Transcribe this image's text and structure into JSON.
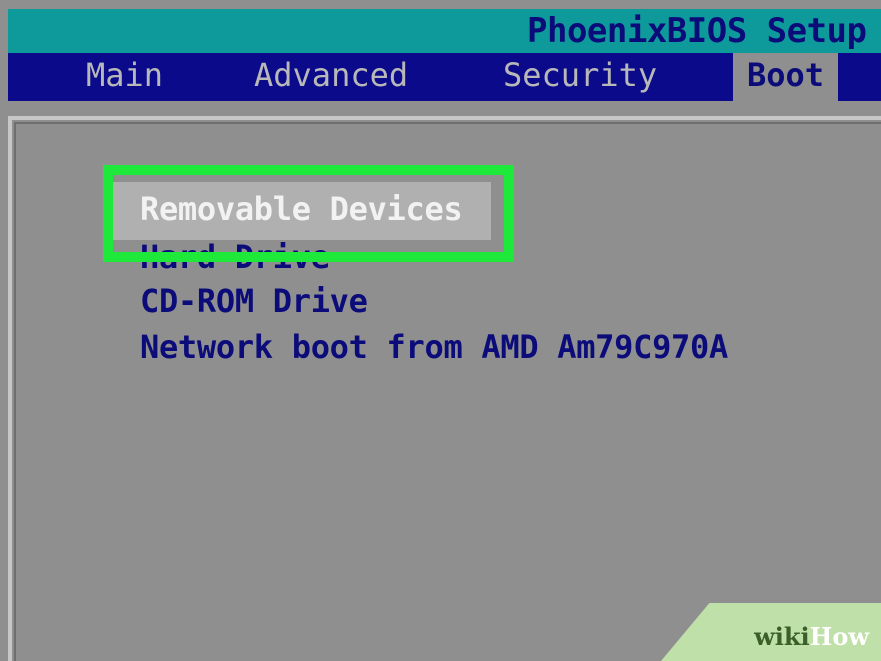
{
  "window": {
    "title": "PhoenixBIOS Setup U"
  },
  "tabs": [
    {
      "label": "Main"
    },
    {
      "label": "Advanced"
    },
    {
      "label": "Security"
    },
    {
      "label": "Boot",
      "active": true
    }
  ],
  "boot_order": {
    "items": [
      {
        "label": "Removable Devices",
        "selected": true
      },
      {
        "label": "Hard Drive",
        "selected": false
      },
      {
        "label": "CD-ROM Drive",
        "selected": false
      },
      {
        "label": "Network boot from AMD Am79C970A",
        "selected": false
      }
    ]
  },
  "colors": {
    "title_bar": "#0e9a9a",
    "menu_bar": "#0a0a8a",
    "panel": "#8f8f8f",
    "text": "#0b0b7a",
    "highlight_outline": "#1ee83a"
  },
  "watermark": {
    "part1": "wiki",
    "part2": "How"
  }
}
